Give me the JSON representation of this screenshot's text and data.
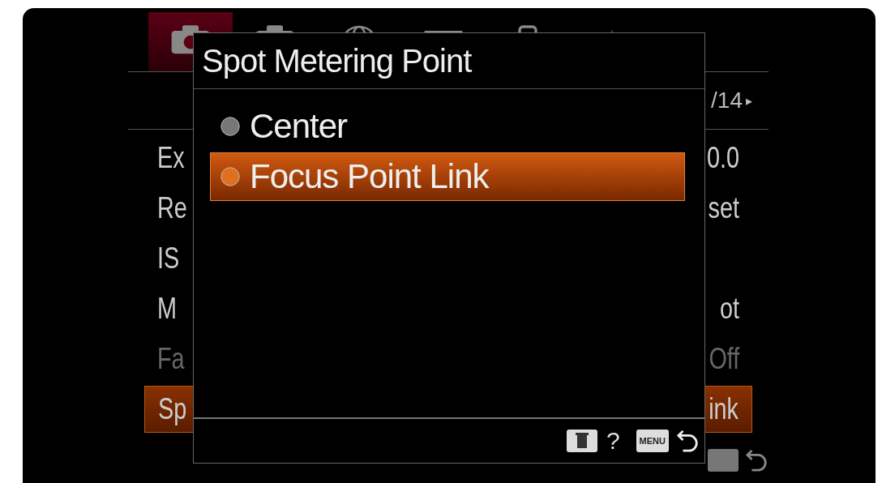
{
  "tabs": [
    {
      "kind": "camera",
      "selected": true
    },
    {
      "kind": "camera",
      "selected": false
    },
    {
      "kind": "globe",
      "selected": false
    },
    {
      "kind": "screen",
      "selected": false
    },
    {
      "kind": "card",
      "selected": false
    },
    {
      "kind": "tool",
      "selected": false
    }
  ],
  "page_indicator": {
    "text": "/14",
    "arrow": "▸"
  },
  "menu_rows": [
    {
      "label": "Ex",
      "value": "0.0",
      "selected": false,
      "disabled": false
    },
    {
      "label": "Re",
      "value": "set",
      "selected": false,
      "disabled": false
    },
    {
      "label": "IS",
      "selected": false,
      "disabled": false
    },
    {
      "label": "M",
      "value": "ot",
      "selected": false,
      "disabled": false
    },
    {
      "label": "Fa",
      "value": "Off",
      "selected": false,
      "disabled": true
    },
    {
      "label": "Sp",
      "value": "ink",
      "selected": true,
      "disabled": false
    }
  ],
  "dialog": {
    "title": "Spot Metering Point",
    "options": [
      {
        "label": "Center",
        "selected": false
      },
      {
        "label": "Focus Point Link",
        "selected": true
      }
    ],
    "footer": {
      "help": "?",
      "menu_key": "MENU"
    }
  }
}
